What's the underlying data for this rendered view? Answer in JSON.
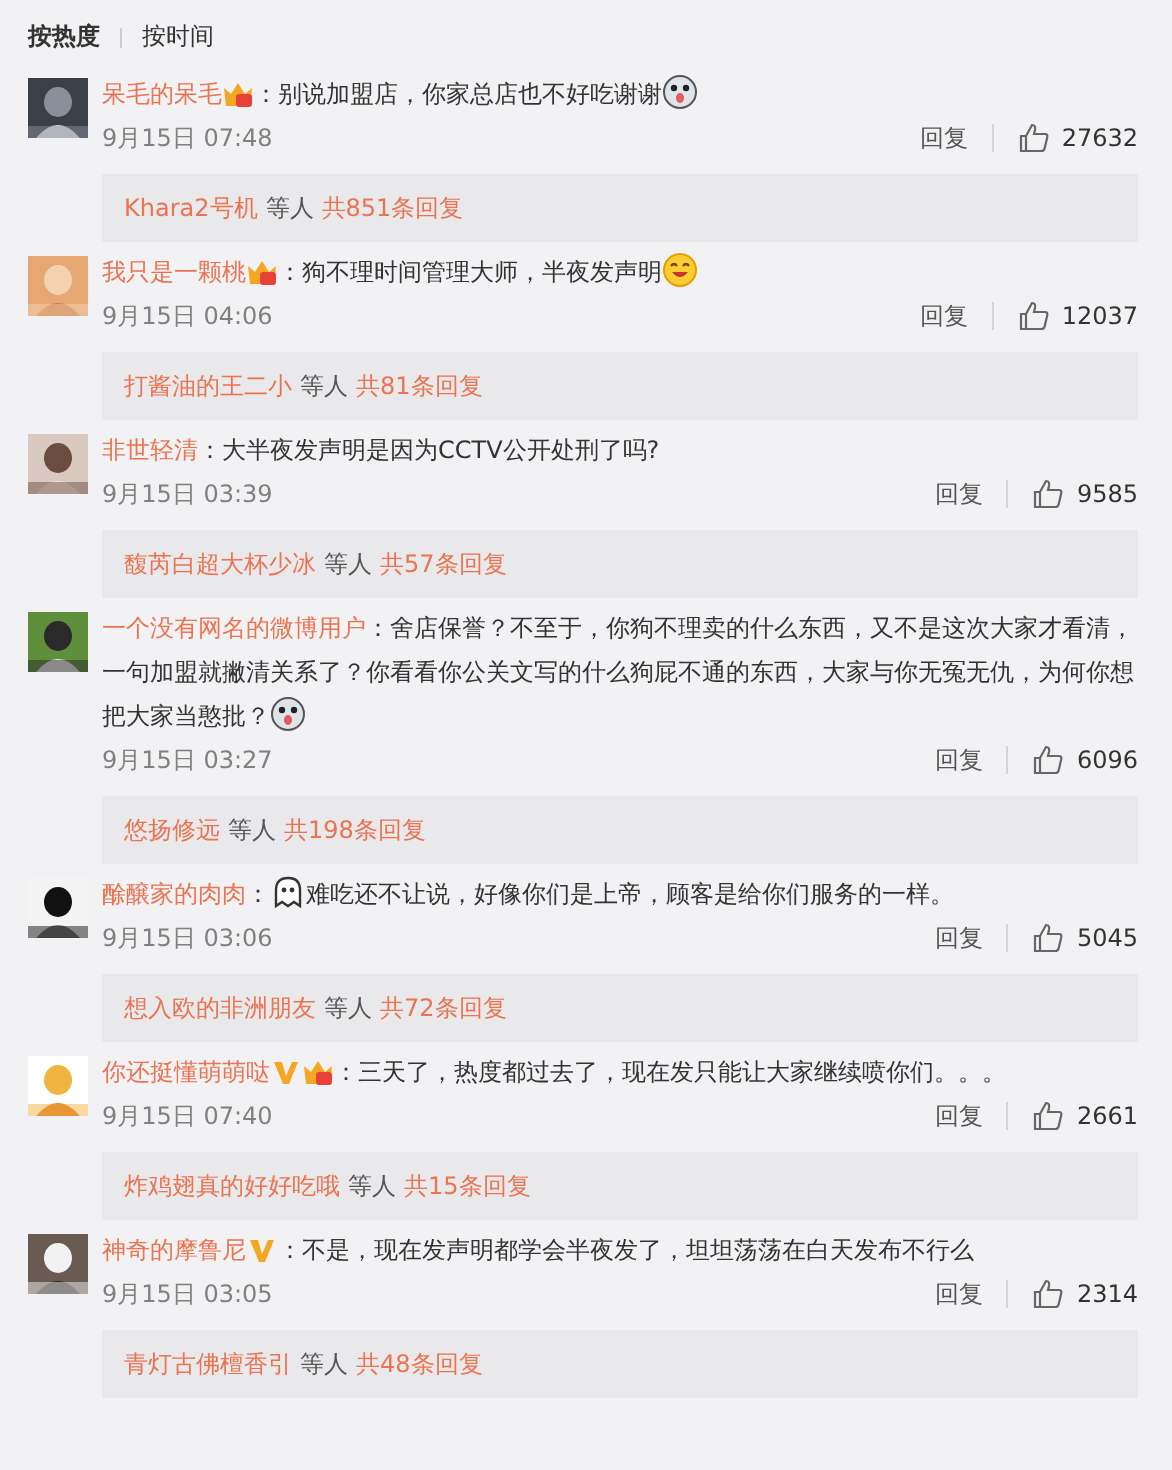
{
  "sort_tabs": [
    {
      "label": "按热度",
      "selected": true
    },
    {
      "label": "按时间",
      "selected": false
    }
  ],
  "comments": [
    {
      "user": "呆毛的呆毛",
      "badges": [
        {
          "kind": "crown"
        }
      ],
      "sep": "：",
      "text": "别说加盟店，你家总店也不好吃谢谢",
      "emoji_after": {
        "kind": "dog"
      },
      "time": "9月15日 07:48",
      "reply": "回复",
      "likes": "27632",
      "thread": {
        "users": "Khara2号机",
        "suffix": "等人",
        "count": "共851条回复"
      }
    },
    {
      "user": "我只是一颗桃",
      "badges": [
        {
          "kind": "crown"
        }
      ],
      "sep": "：",
      "text": "狗不理时间管理大师，半夜发声明",
      "emoji_after": {
        "kind": "smile"
      },
      "time": "9月15日 04:06",
      "reply": "回复",
      "likes": "12037",
      "thread": {
        "users": "打酱油的王二小",
        "suffix": "等人",
        "count": "共81条回复"
      }
    },
    {
      "user": "非世轻清",
      "sep": "：",
      "text": "大半夜发声明是因为CCTV公开处刑了吗?",
      "time": "9月15日 03:39",
      "reply": "回复",
      "likes": "9585",
      "thread": {
        "users": "馥芮白超大杯少冰",
        "suffix": "等人",
        "count": "共57条回复"
      }
    },
    {
      "user": "一个没有网名的微博用户",
      "sep": "：",
      "text": "舍店保誉？不至于，你狗不理卖的什么东西，又不是这次大家才看清，一句加盟就撇清关系了？你看看你公关文写的什么狗屁不通的东西，大家与你无冤无仇，为何你想把大家当憨批？",
      "emoji_after": {
        "kind": "dog"
      },
      "time": "9月15日 03:27",
      "reply": "回复",
      "likes": "6096",
      "thread": {
        "users": "悠扬修远",
        "suffix": "等人",
        "count": "共198条回复"
      }
    },
    {
      "user": "酴醸家的肉肉",
      "sep": "：",
      "emoji_before": {
        "kind": "ghost"
      },
      "text": "难吃还不让说，好像你们是上帝，顾客是给你们服务的一样。",
      "time": "9月15日 03:06",
      "reply": "回复",
      "likes": "5045",
      "thread": {
        "users": "想入欧的非洲朋友",
        "suffix": "等人",
        "count": "共72条回复"
      }
    },
    {
      "user": "你还挺懂萌萌哒",
      "badges": [
        {
          "kind": "v"
        },
        {
          "kind": "crown"
        }
      ],
      "sep": "：",
      "text": "三天了，热度都过去了，现在发只能让大家继续喷你们。。。",
      "time": "9月15日 07:40",
      "reply": "回复",
      "likes": "2661",
      "thread": {
        "users": "炸鸡翅真的好好吃哦",
        "suffix": "等人",
        "count": "共15条回复"
      }
    },
    {
      "user": "神奇的摩鲁尼",
      "badges": [
        {
          "kind": "v"
        }
      ],
      "sep": "：",
      "text": "不是，现在发声明都学会半夜发了，坦坦荡荡在白天发布不行么",
      "time": "9月15日 03:05",
      "reply": "回复",
      "likes": "2314",
      "thread": {
        "users": "青灯古佛檀香引",
        "suffix": "等人",
        "count": "共48条回复"
      }
    }
  ]
}
